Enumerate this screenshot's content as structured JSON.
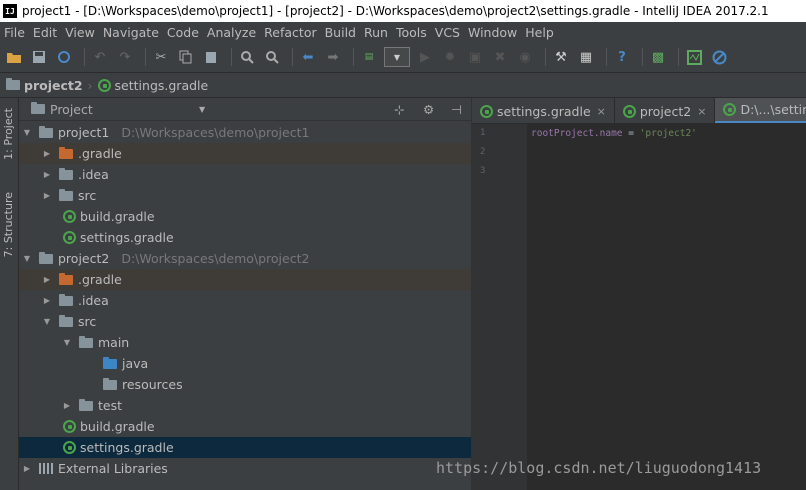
{
  "window": {
    "title": "project1 - [D:\\Workspaces\\demo\\project1] - [project2] - D:\\Workspaces\\demo\\project2\\settings.gradle - IntelliJ IDEA 2017.2.1",
    "logo": "IJ"
  },
  "menu": [
    "File",
    "Edit",
    "View",
    "Navigate",
    "Code",
    "Analyze",
    "Refactor",
    "Build",
    "Run",
    "Tools",
    "VCS",
    "Window",
    "Help"
  ],
  "toolbar": {
    "icons": [
      "open-folder-icon",
      "save-icon",
      "sync-icon",
      "undo-icon",
      "redo-icon",
      "cut-icon",
      "copy-icon",
      "paste-icon",
      "find-icon",
      "replace-icon",
      "back-icon",
      "forward-icon",
      "build-icon",
      "run-config-dropdown",
      "run-icon",
      "debug-icon",
      "coverage-icon",
      "stop-icon",
      "attach-icon",
      "project-structure-icon",
      "sdk-icon",
      "help-icon",
      "gradle-icon",
      "tasks-icon",
      "no-icon"
    ]
  },
  "breadcrumb": {
    "project": "project2",
    "file": "settings.gradle"
  },
  "sidebar": {
    "project_tab": "1: Project",
    "structure_tab": "7: Structure"
  },
  "panel": {
    "title": "Project"
  },
  "tree": [
    {
      "label": "project1",
      "path": "D:\\Workspaces\\demo\\project1"
    },
    {
      "label": ".gradle"
    },
    {
      "label": ".idea"
    },
    {
      "label": "src"
    },
    {
      "label": "build.gradle"
    },
    {
      "label": "settings.gradle"
    },
    {
      "label": "project2",
      "path": "D:\\Workspaces\\demo\\project2"
    },
    {
      "label": ".gradle"
    },
    {
      "label": ".idea"
    },
    {
      "label": "src"
    },
    {
      "label": "main"
    },
    {
      "label": "java"
    },
    {
      "label": "resources"
    },
    {
      "label": "test"
    },
    {
      "label": "build.gradle"
    },
    {
      "label": "settings.gradle"
    },
    {
      "label": "External Libraries"
    }
  ],
  "editor": {
    "tabs": [
      {
        "label": "settings.gradle",
        "close": "×"
      },
      {
        "label": "project2",
        "close": "×"
      },
      {
        "label": "D:\\...\\setting"
      }
    ],
    "line_numbers": [
      "1",
      "2",
      "3"
    ],
    "code": {
      "var": "rootProject",
      "prop": ".name",
      "op": " = ",
      "str": "'project2'"
    }
  },
  "watermark": "https://blog.csdn.net/liuguodong1413"
}
